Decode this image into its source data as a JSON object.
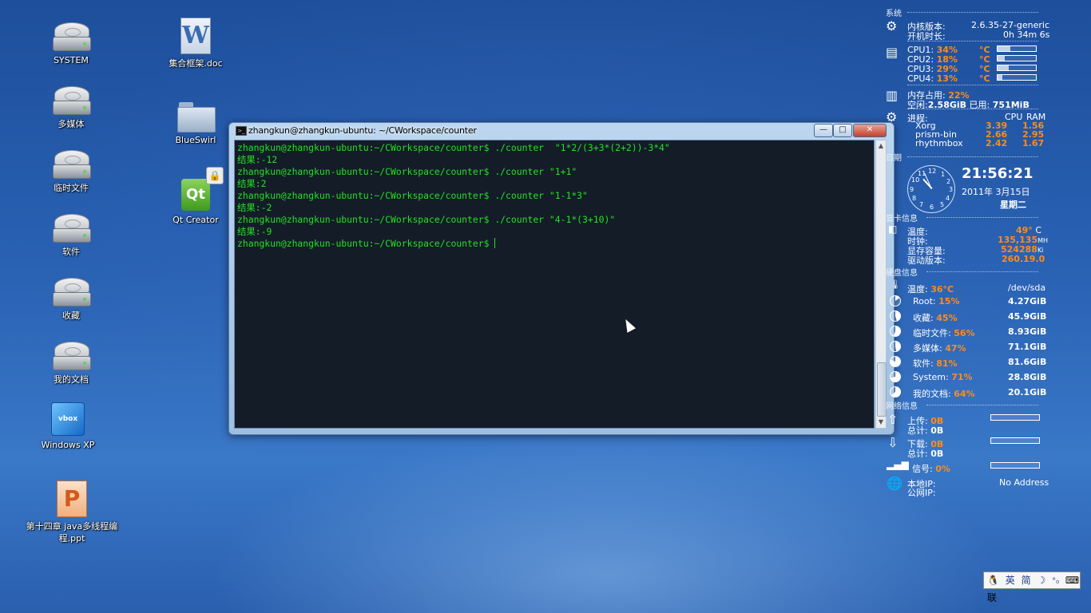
{
  "desktop": {
    "icons": [
      {
        "label": "SYSTEM"
      },
      {
        "label": "多媒体"
      },
      {
        "label": "临时文件"
      },
      {
        "label": "软件"
      },
      {
        "label": "收藏"
      },
      {
        "label": "我的文档"
      },
      {
        "label": "Windows XP"
      },
      {
        "label": "第十四章 java多线程编程.ppt"
      },
      {
        "label": "集合框架.doc"
      },
      {
        "label": "BlueSwirl"
      },
      {
        "label": "Qt Creator"
      }
    ]
  },
  "terminal": {
    "title": "zhangkun@zhangkun-ubuntu: ~/CWorkspace/counter",
    "lines": [
      "zhangkun@zhangkun-ubuntu:~/CWorkspace/counter$ ./counter  \"1*2/(3+3*(2+2))-3*4\"",
      "结果:-12",
      "zhangkun@zhangkun-ubuntu:~/CWorkspace/counter$ ./counter \"1+1\"",
      "结果:2",
      "zhangkun@zhangkun-ubuntu:~/CWorkspace/counter$ ./counter \"1-1*3\"",
      "结果:-2",
      "zhangkun@zhangkun-ubuntu:~/CWorkspace/counter$ ./counter \"4-1*(3+10)\"",
      "结果:-9",
      "zhangkun@zhangkun-ubuntu:~/CWorkspace/counter$ "
    ],
    "buttons": {
      "minimize": "—",
      "maximize": "□",
      "close": "✕"
    }
  },
  "conky": {
    "system": {
      "title": "系统",
      "kernel_label": "内核版本:",
      "kernel": "2.6.35-27-generic",
      "uptime_label": "开机时长:",
      "uptime": "0h 34m 6s"
    },
    "cpu": [
      {
        "label": "CPU1:",
        "pct": "34%",
        "unit": "°C",
        "usage": 0.34
      },
      {
        "label": "CPU2:",
        "pct": "18%",
        "unit": "°C",
        "usage": 0.18
      },
      {
        "label": "CPU3:",
        "pct": "29%",
        "unit": "°C",
        "usage": 0.29
      },
      {
        "label": "CPU4:",
        "pct": "13%",
        "unit": "°C",
        "usage": 0.13
      }
    ],
    "memory": {
      "used_label": "内存占用:",
      "used_pct": "22%",
      "free_label": "空闲:",
      "free": "2.58GiB",
      "in_use_label": "已用:",
      "in_use": "751MiB"
    },
    "processes": {
      "label": "进程:",
      "cpu_header": "CPU",
      "ram_header": "RAM",
      "rows": [
        {
          "name": "Xorg",
          "cpu": "3.39",
          "ram": "1.56"
        },
        {
          "name": "prism-bin",
          "cpu": "2.66",
          "ram": "2.95"
        },
        {
          "name": "rhythmbox",
          "cpu": "2.42",
          "ram": "1.67"
        }
      ]
    },
    "date": {
      "title": "日期",
      "time": "21:56:21",
      "date": "2011年 3月15日",
      "weekday": "星期二",
      "clock_numbers": [
        "12",
        "1",
        "2",
        "3",
        "4",
        "5",
        "6",
        "7",
        "8",
        "9",
        "10",
        "11"
      ]
    },
    "gpu": {
      "title": "显卡信息",
      "temp_label": "温度:",
      "temp": "49°",
      "temp_unit": "C",
      "clock_label": "时钟:",
      "clock": "135,135",
      "clock_unit": "MH",
      "vram_label": "显存容量:",
      "vram": "524288",
      "vram_unit": "Ki",
      "driver_label": "驱动版本:",
      "driver": "260.19.0"
    },
    "disk": {
      "title": "硬盘信息",
      "temp_label": "温度:",
      "temp": "36°C",
      "device": "/dev/sda",
      "rows": [
        {
          "label": "Root:",
          "pct": "15%",
          "size": "4.27GiB",
          "used": 0.15
        },
        {
          "label": "收藏:",
          "pct": "45%",
          "size": "45.9GiB",
          "used": 0.45
        },
        {
          "label": "临时文件:",
          "pct": "56%",
          "size": "8.93GiB",
          "used": 0.56
        },
        {
          "label": "多媒体:",
          "pct": "47%",
          "size": "71.1GiB",
          "used": 0.47
        },
        {
          "label": "软件:",
          "pct": "81%",
          "size": "81.6GiB",
          "used": 0.81
        },
        {
          "label": "System:",
          "pct": "71%",
          "size": "28.8GiB",
          "used": 0.71
        },
        {
          "label": "我的文档:",
          "pct": "64%",
          "size": "20.1GiB",
          "used": 0.64
        }
      ]
    },
    "network": {
      "title": "网络信息",
      "up_label": "上传:",
      "up": "0B",
      "up_total_label": "总计:",
      "up_total": "0B",
      "down_label": "下载:",
      "down": "0B",
      "down_total_label": "总计:",
      "down_total": "0B",
      "signal_label": "信号:",
      "signal": "0%",
      "local_ip_label": "本地IP:",
      "local_ip": "No Address",
      "public_ip_label": "公网IP:"
    }
  },
  "tray": {
    "lang": "英",
    "simp": "简",
    "moon": "☽",
    "dots": "°₀",
    "keyboard": "⌨",
    "lian": "联"
  },
  "colors": {
    "accent": "#ff8c1a",
    "terminal_text": "#22e122",
    "terminal_bg": "#141c28"
  }
}
